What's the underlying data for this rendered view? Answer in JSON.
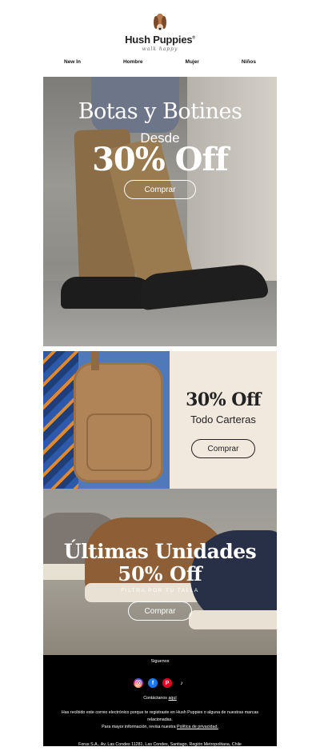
{
  "header": {
    "brand": "Hush Puppies",
    "brand_mark": "®",
    "tagline": "walk happy"
  },
  "nav": {
    "items": [
      "New In",
      "Hombre",
      "Mujer",
      "Niños"
    ]
  },
  "hero": {
    "title": "Botas y Botines",
    "subtitle": "Desde",
    "discount": "30% Off",
    "button": "Comprar"
  },
  "bags": {
    "discount": "30% Off",
    "subtitle": "Todo Carteras",
    "button": "Comprar"
  },
  "shoes": {
    "title": "Últimas Unidades",
    "discount": "50% Off",
    "filter": "FILTRA POR TU TALLA",
    "button": "Comprar"
  },
  "footer": {
    "follow": "Siguenos",
    "socials": [
      "instagram",
      "facebook",
      "pinterest",
      "tiktok"
    ],
    "contact_prefix": "Contáctanos",
    "contact_link": "aquí",
    "legal_line1": "Has recibido este correo electrónico porque te registraste en Hush Puppies o alguna de nuestras marcas relacionadas.",
    "legal_line2_prefix": "Para mayor información, revisa nuestra",
    "legal_link": "Política de privacidad.",
    "address": "Forus S.A., Av. Las Condes 11281, Las Condes, Santiago, Región Metropolitana, Chile"
  }
}
